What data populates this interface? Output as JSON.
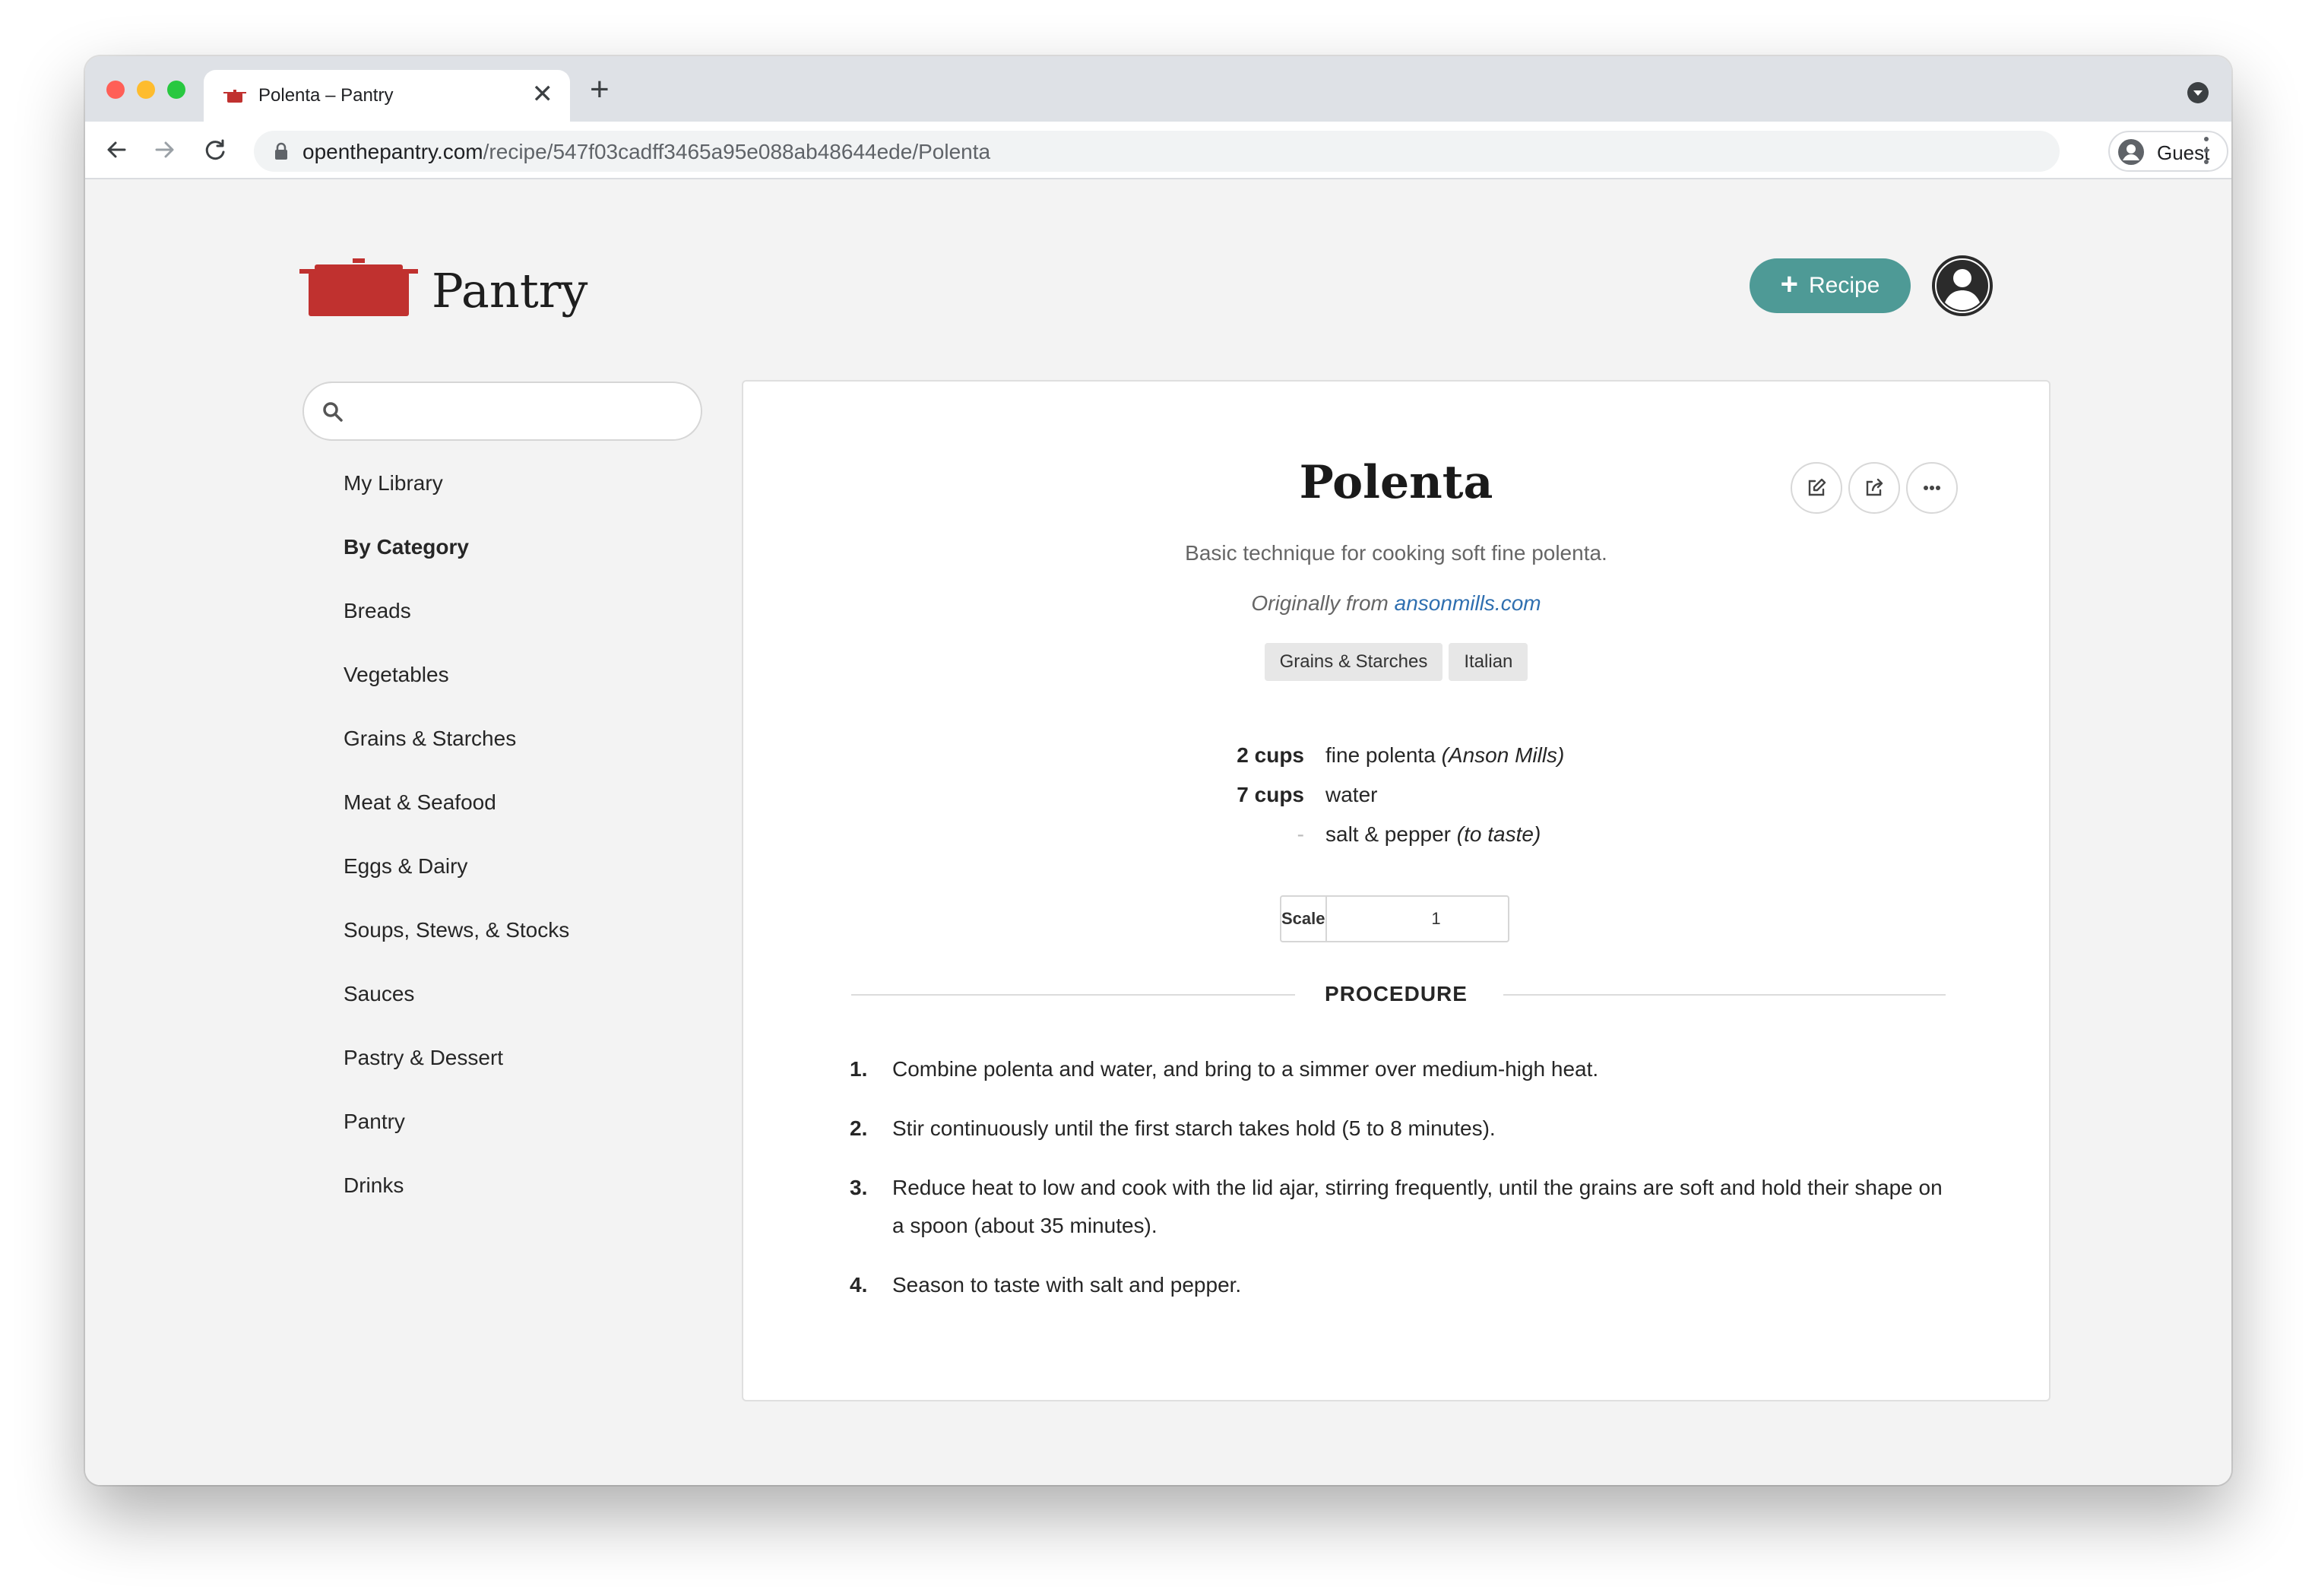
{
  "browser": {
    "tab_title": "Polenta – Pantry",
    "new_tab_label": "+",
    "close_label": "✕",
    "url_host": "openthepantry.com",
    "url_path": "/recipe/547f03cadff3465a95e088ab48644ede/Polenta",
    "profile_label": "Guest"
  },
  "header": {
    "brand": "Pantry",
    "add_recipe_label": "Recipe",
    "add_recipe_plus": "+"
  },
  "search": {
    "placeholder": "",
    "value": ""
  },
  "sidebar": {
    "items": [
      {
        "label": "My Library",
        "bold": false
      },
      {
        "label": "By Category",
        "bold": true
      },
      {
        "label": "Breads",
        "bold": false
      },
      {
        "label": "Vegetables",
        "bold": false
      },
      {
        "label": "Grains & Starches",
        "bold": false
      },
      {
        "label": "Meat & Seafood",
        "bold": false
      },
      {
        "label": "Eggs & Dairy",
        "bold": false
      },
      {
        "label": "Soups, Stews, & Stocks",
        "bold": false
      },
      {
        "label": "Sauces",
        "bold": false
      },
      {
        "label": "Pastry & Dessert",
        "bold": false
      },
      {
        "label": "Pantry",
        "bold": false
      },
      {
        "label": "Drinks",
        "bold": false
      }
    ]
  },
  "recipe": {
    "title": "Polenta",
    "subtitle": "Basic technique for cooking soft fine polenta.",
    "source_prefix": "Originally from",
    "source_link": "ansonmills.com",
    "tags": [
      "Grains & Starches",
      "Italian"
    ],
    "ingredients": [
      {
        "qty": "2 cups",
        "name": "fine polenta",
        "note": "(Anson Mills)"
      },
      {
        "qty": "7 cups",
        "name": "water",
        "note": ""
      },
      {
        "qty": "-",
        "name": "salt & pepper",
        "note": "(to taste)"
      }
    ],
    "scale_label": "Scale",
    "scale_value": "1",
    "procedure_heading": "PROCEDURE",
    "steps": [
      {
        "num": "1.",
        "text": "Combine polenta and water, and bring to a simmer over medium-high heat."
      },
      {
        "num": "2.",
        "text": "Stir continuously until the first starch takes hold (5 to 8 minutes)."
      },
      {
        "num": "3.",
        "text": "Reduce heat to low and cook with the lid ajar, stirring frequently, until the grains are soft and hold their shape on a spoon (about 35 minutes)."
      },
      {
        "num": "4.",
        "text": "Season to taste with salt and pepper."
      }
    ]
  },
  "colors": {
    "accent": "#4e9a96",
    "brand_red": "#c0312f",
    "link": "#2f6fb0"
  }
}
